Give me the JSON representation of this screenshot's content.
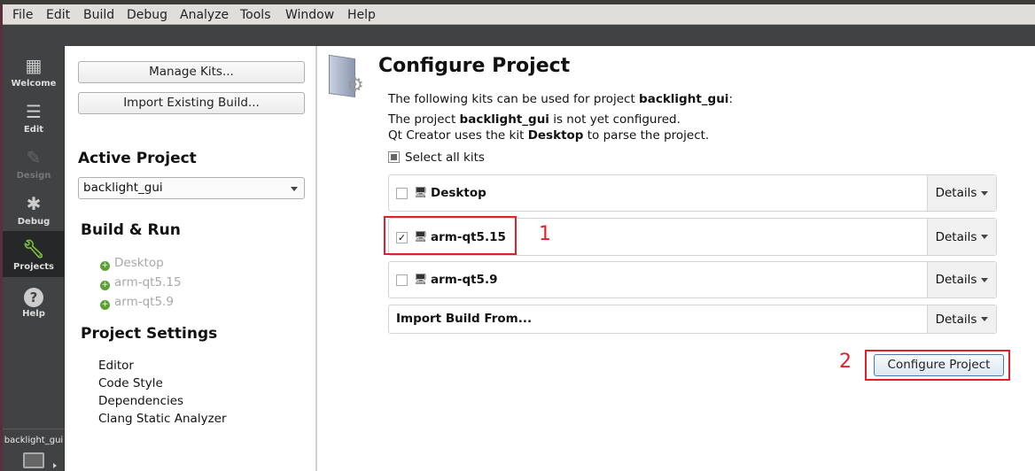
{
  "menu": [
    "File",
    "Edit",
    "Build",
    "Debug",
    "Analyze",
    "Tools",
    "Window",
    "Help"
  ],
  "modes": [
    {
      "label": "Welcome",
      "icon": "grid-icon"
    },
    {
      "label": "Edit",
      "icon": "document-icon"
    },
    {
      "label": "Design",
      "icon": "pencil-icon"
    },
    {
      "label": "Debug",
      "icon": "bug-icon"
    },
    {
      "label": "Projects",
      "icon": "wrench-icon"
    },
    {
      "label": "Help",
      "icon": "help-icon"
    }
  ],
  "active_mode": "Projects",
  "target_selector": {
    "project": "backlight_gui",
    "icon": "monitor-icon"
  },
  "left": {
    "manage_kits": "Manage Kits...",
    "import_build": "Import Existing Build...",
    "active_project_heading": "Active Project",
    "project_combo": "backlight_gui",
    "build_run_heading": "Build & Run",
    "build_run_items": [
      "Desktop",
      "arm-qt5.15",
      "arm-qt5.9"
    ],
    "project_settings_heading": "Project Settings",
    "project_settings_items": [
      "Editor",
      "Code Style",
      "Dependencies",
      "Clang Static Analyzer"
    ]
  },
  "main": {
    "title": "Configure Project",
    "line1_pre": "The following kits can be used for project ",
    "line1_bold": "backlight_gui",
    "line1_post": ":",
    "line2_pre": "The project ",
    "line2_bold": "backlight_gui",
    "line2_post": " is not yet configured.",
    "line3_pre": "Qt Creator uses the kit ",
    "line3_bold": "Desktop",
    "line3_post": " to parse the project.",
    "select_all": "Select all kits",
    "kits": [
      {
        "name": "Desktop",
        "checked": false,
        "details": "Details"
      },
      {
        "name": "arm-qt5.15",
        "checked": true,
        "details": "Details"
      },
      {
        "name": "arm-qt5.9",
        "checked": false,
        "details": "Details"
      }
    ],
    "import_from": "Import Build From...",
    "import_details": "Details",
    "configure_button": "Configure Project"
  },
  "annotations": {
    "label1": "1",
    "label2": "2",
    "color": "#e3202a"
  },
  "accent": "#5ba033"
}
